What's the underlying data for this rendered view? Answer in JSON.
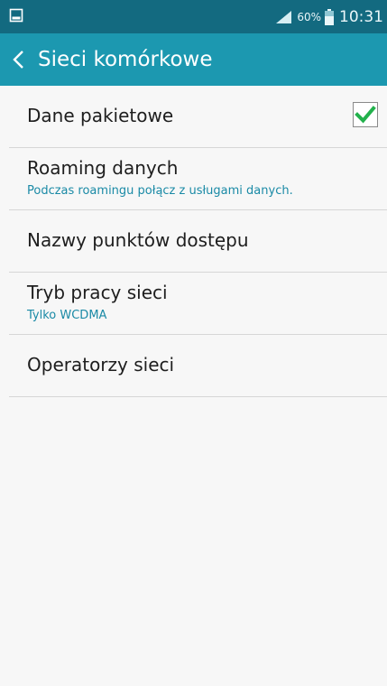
{
  "status_bar": {
    "left_icon": "image-notification-icon",
    "signal_icon": "signal-icon",
    "battery_percent": "60%",
    "battery_icon": "battery-icon",
    "time": "10:31",
    "background_color": "#136a80"
  },
  "action_bar": {
    "back_icon": "chevron-left-icon",
    "title": "Sieci komórkowe",
    "background_color": "#1c98b0"
  },
  "settings": {
    "items": [
      {
        "title": "Dane pakietowe",
        "checked": true,
        "check_color": "#22b14c"
      },
      {
        "title": "Roaming danych",
        "subtitle": "Podczas roamingu połącz z usługami danych."
      },
      {
        "title": "Nazwy punktów dostępu"
      },
      {
        "title": "Tryb pracy sieci",
        "subtitle": "Tylko WCDMA"
      },
      {
        "title": "Operatorzy sieci"
      }
    ]
  }
}
